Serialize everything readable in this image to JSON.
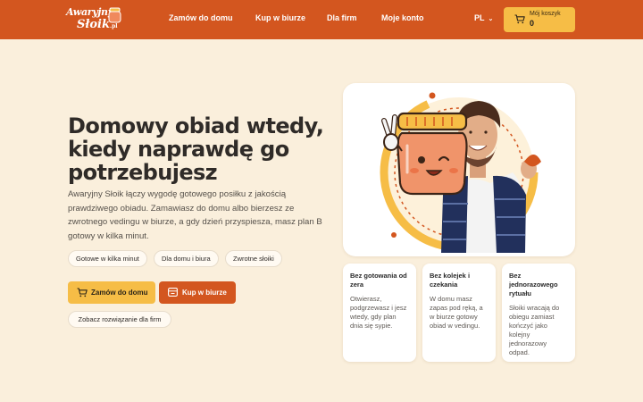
{
  "header": {
    "logo_line1": "Awaryjny",
    "logo_line2": "Słoik",
    "logo_suffix": ".pl",
    "nav": [
      {
        "label": "Zamów do domu"
      },
      {
        "label": "Kup w biurze"
      },
      {
        "label": "Dla firm"
      },
      {
        "label": "Moje konto"
      }
    ],
    "language": "PL",
    "cart_label": "Mój koszyk",
    "cart_count": "0",
    "brand_color": "#d3561f",
    "accent_color": "#f6bd46"
  },
  "hero": {
    "headline": "Domowy obiad wtedy, kiedy naprawdę go potrzebujesz",
    "lead": "Awaryjny Słoik łączy wygodę gotowego posiłku z jakością prawdziwego obiadu. Zamawiasz do domu albo bierzesz ze zwrotnego vedingu w biurze, a gdy dzień przyspiesza, masz plan B gotowy w kilka minut.",
    "chips": [
      {
        "label": "Gotowe w kilka minut"
      },
      {
        "label": "Dla domu i biura"
      },
      {
        "label": "Zwrotne słoiki"
      }
    ],
    "primary_button": "Zamów do domu",
    "secondary_button": "Kup w biurze",
    "link_button": "Zobacz rozwiązanie dla firm"
  },
  "features": [
    {
      "title": "Bez gotowania od zera",
      "text": "Otwierasz, podgrzewasz i jesz wtedy, gdy plan dnia się sypie."
    },
    {
      "title": "Bez kolejek i czekania",
      "text": "W domu masz zapas pod ręką, a w biurze gotowy obiad w vedingu."
    },
    {
      "title": "Bez jednorazowego rytuału",
      "text": "Słoiki wracają do obiegu zamiast kończyć jako kolejny jednorazowy odpad."
    }
  ]
}
